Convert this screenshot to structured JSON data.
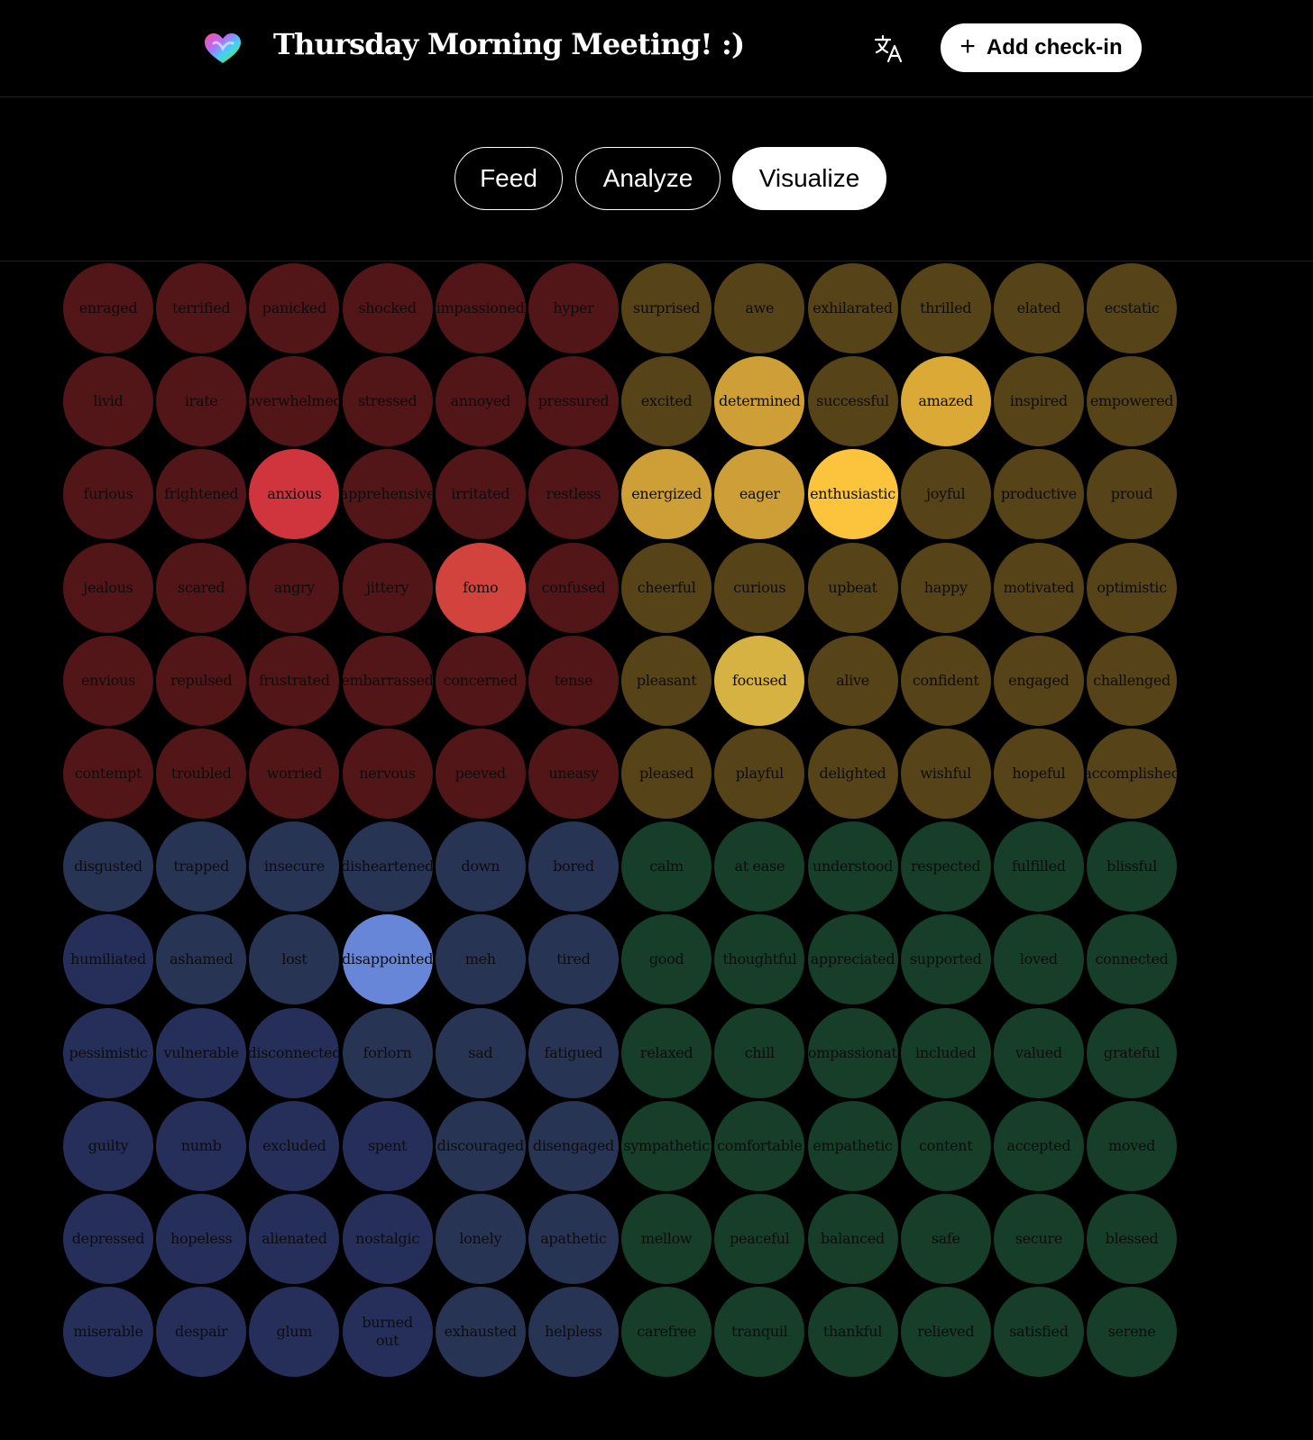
{
  "header": {
    "title": "Thursday Morning Meeting! :)",
    "logo_icon": "heart-logo-icon",
    "translate_icon": "translate-icon",
    "add_button_label": "Add check-in",
    "add_icon": "plus-icon"
  },
  "tabs": [
    {
      "label": "Feed",
      "active": false
    },
    {
      "label": "Analyze",
      "active": false
    },
    {
      "label": "Visualize",
      "active": true
    }
  ],
  "colors": {
    "red": "#521619",
    "red_active": "#d0353d",
    "red_active2": "#d2433d",
    "yellow": "#574318",
    "yellow_mid": "#cd9f36",
    "yellow_hi": "#dba935",
    "yellow_top": "#fcc43d",
    "yellow_focus": "#d6b242",
    "blue": "#283454",
    "blue_dark": "#262f5a",
    "blue_active": "#6886d7",
    "green": "#163e28"
  },
  "mood_rows": [
    [
      {
        "label": "enraged",
        "c": "red"
      },
      {
        "label": "terrified",
        "c": "red"
      },
      {
        "label": "panicked",
        "c": "red"
      },
      {
        "label": "shocked",
        "c": "red"
      },
      {
        "label": "impassioned",
        "c": "red"
      },
      {
        "label": "hyper",
        "c": "red"
      },
      {
        "label": "surprised",
        "c": "yellow"
      },
      {
        "label": "awe",
        "c": "yellow"
      },
      {
        "label": "exhilarated",
        "c": "yellow"
      },
      {
        "label": "thrilled",
        "c": "yellow"
      },
      {
        "label": "elated",
        "c": "yellow"
      },
      {
        "label": "ecstatic",
        "c": "yellow"
      }
    ],
    [
      {
        "label": "livid",
        "c": "red"
      },
      {
        "label": "irate",
        "c": "red"
      },
      {
        "label": "overwhelmed",
        "c": "red"
      },
      {
        "label": "stressed",
        "c": "red"
      },
      {
        "label": "annoyed",
        "c": "red"
      },
      {
        "label": "pressured",
        "c": "red"
      },
      {
        "label": "excited",
        "c": "yellow"
      },
      {
        "label": "determined",
        "c": "yellow_mid"
      },
      {
        "label": "successful",
        "c": "yellow"
      },
      {
        "label": "amazed",
        "c": "yellow_hi"
      },
      {
        "label": "inspired",
        "c": "yellow"
      },
      {
        "label": "empowered",
        "c": "yellow"
      }
    ],
    [
      {
        "label": "furious",
        "c": "red"
      },
      {
        "label": "frightened",
        "c": "red"
      },
      {
        "label": "anxious",
        "c": "red_active"
      },
      {
        "label": "apprehensive",
        "c": "red"
      },
      {
        "label": "irritated",
        "c": "red"
      },
      {
        "label": "restless",
        "c": "red"
      },
      {
        "label": "energized",
        "c": "yellow_mid"
      },
      {
        "label": "eager",
        "c": "yellow_mid"
      },
      {
        "label": "enthusiastic",
        "c": "yellow_top"
      },
      {
        "label": "joyful",
        "c": "yellow"
      },
      {
        "label": "productive",
        "c": "yellow"
      },
      {
        "label": "proud",
        "c": "yellow"
      }
    ],
    [
      {
        "label": "jealous",
        "c": "red"
      },
      {
        "label": "scared",
        "c": "red"
      },
      {
        "label": "angry",
        "c": "red"
      },
      {
        "label": "jittery",
        "c": "red"
      },
      {
        "label": "fomo",
        "c": "red_active2"
      },
      {
        "label": "confused",
        "c": "red"
      },
      {
        "label": "cheerful",
        "c": "yellow"
      },
      {
        "label": "curious",
        "c": "yellow"
      },
      {
        "label": "upbeat",
        "c": "yellow"
      },
      {
        "label": "happy",
        "c": "yellow"
      },
      {
        "label": "motivated",
        "c": "yellow"
      },
      {
        "label": "optimistic",
        "c": "yellow"
      }
    ],
    [
      {
        "label": "envious",
        "c": "red"
      },
      {
        "label": "repulsed",
        "c": "red"
      },
      {
        "label": "frustrated",
        "c": "red"
      },
      {
        "label": "embarrassed",
        "c": "red"
      },
      {
        "label": "concerned",
        "c": "red"
      },
      {
        "label": "tense",
        "c": "red"
      },
      {
        "label": "pleasant",
        "c": "yellow"
      },
      {
        "label": "focused",
        "c": "yellow_focus"
      },
      {
        "label": "alive",
        "c": "yellow"
      },
      {
        "label": "confident",
        "c": "yellow"
      },
      {
        "label": "engaged",
        "c": "yellow"
      },
      {
        "label": "challenged",
        "c": "yellow"
      }
    ],
    [
      {
        "label": "contempt",
        "c": "red"
      },
      {
        "label": "troubled",
        "c": "red"
      },
      {
        "label": "worried",
        "c": "red"
      },
      {
        "label": "nervous",
        "c": "red"
      },
      {
        "label": "peeved",
        "c": "red"
      },
      {
        "label": "uneasy",
        "c": "red"
      },
      {
        "label": "pleased",
        "c": "yellow"
      },
      {
        "label": "playful",
        "c": "yellow"
      },
      {
        "label": "delighted",
        "c": "yellow"
      },
      {
        "label": "wishful",
        "c": "yellow"
      },
      {
        "label": "hopeful",
        "c": "yellow"
      },
      {
        "label": "accomplished",
        "c": "yellow"
      }
    ],
    [
      {
        "label": "disgusted",
        "c": "blue"
      },
      {
        "label": "trapped",
        "c": "blue"
      },
      {
        "label": "insecure",
        "c": "blue"
      },
      {
        "label": "disheartened",
        "c": "blue"
      },
      {
        "label": "down",
        "c": "blue"
      },
      {
        "label": "bored",
        "c": "blue"
      },
      {
        "label": "calm",
        "c": "green"
      },
      {
        "label": "at ease",
        "c": "green"
      },
      {
        "label": "understood",
        "c": "green"
      },
      {
        "label": "respected",
        "c": "green"
      },
      {
        "label": "fulfilled",
        "c": "green"
      },
      {
        "label": "blissful",
        "c": "green"
      }
    ],
    [
      {
        "label": "humiliated",
        "c": "blue_dark"
      },
      {
        "label": "ashamed",
        "c": "blue"
      },
      {
        "label": "lost",
        "c": "blue"
      },
      {
        "label": "disappointed",
        "c": "blue_active"
      },
      {
        "label": "meh",
        "c": "blue"
      },
      {
        "label": "tired",
        "c": "blue"
      },
      {
        "label": "good",
        "c": "green"
      },
      {
        "label": "thoughtful",
        "c": "green"
      },
      {
        "label": "appreciated",
        "c": "green"
      },
      {
        "label": "supported",
        "c": "green"
      },
      {
        "label": "loved",
        "c": "green"
      },
      {
        "label": "connected",
        "c": "green"
      }
    ],
    [
      {
        "label": "pessimistic",
        "c": "blue_dark"
      },
      {
        "label": "vulnerable",
        "c": "blue_dark"
      },
      {
        "label": "disconnected",
        "c": "blue_dark"
      },
      {
        "label": "forlorn",
        "c": "blue"
      },
      {
        "label": "sad",
        "c": "blue"
      },
      {
        "label": "fatigued",
        "c": "blue"
      },
      {
        "label": "relaxed",
        "c": "green"
      },
      {
        "label": "chill",
        "c": "green"
      },
      {
        "label": "compassionate",
        "c": "green"
      },
      {
        "label": "included",
        "c": "green"
      },
      {
        "label": "valued",
        "c": "green"
      },
      {
        "label": "grateful",
        "c": "green"
      }
    ],
    [
      {
        "label": "guilty",
        "c": "blue_dark"
      },
      {
        "label": "numb",
        "c": "blue_dark"
      },
      {
        "label": "excluded",
        "c": "blue_dark"
      },
      {
        "label": "spent",
        "c": "blue_dark"
      },
      {
        "label": "discouraged",
        "c": "blue"
      },
      {
        "label": "disengaged",
        "c": "blue"
      },
      {
        "label": "sympathetic",
        "c": "green"
      },
      {
        "label": "comfortable",
        "c": "green"
      },
      {
        "label": "empathetic",
        "c": "green"
      },
      {
        "label": "content",
        "c": "green"
      },
      {
        "label": "accepted",
        "c": "green"
      },
      {
        "label": "moved",
        "c": "green"
      }
    ],
    [
      {
        "label": "depressed",
        "c": "blue_dark"
      },
      {
        "label": "hopeless",
        "c": "blue_dark"
      },
      {
        "label": "alienated",
        "c": "blue_dark"
      },
      {
        "label": "nostalgic",
        "c": "blue_dark"
      },
      {
        "label": "lonely",
        "c": "blue"
      },
      {
        "label": "apathetic",
        "c": "blue"
      },
      {
        "label": "mellow",
        "c": "green"
      },
      {
        "label": "peaceful",
        "c": "green"
      },
      {
        "label": "balanced",
        "c": "green"
      },
      {
        "label": "safe",
        "c": "green"
      },
      {
        "label": "secure",
        "c": "green"
      },
      {
        "label": "blessed",
        "c": "green"
      }
    ],
    [
      {
        "label": "miserable",
        "c": "blue_dark"
      },
      {
        "label": "despair",
        "c": "blue_dark"
      },
      {
        "label": "glum",
        "c": "blue_dark"
      },
      {
        "label": "burned out",
        "c": "blue_dark",
        "wrap": true
      },
      {
        "label": "exhausted",
        "c": "blue"
      },
      {
        "label": "helpless",
        "c": "blue"
      },
      {
        "label": "carefree",
        "c": "green"
      },
      {
        "label": "tranquil",
        "c": "green"
      },
      {
        "label": "thankful",
        "c": "green"
      },
      {
        "label": "relieved",
        "c": "green"
      },
      {
        "label": "satisfied",
        "c": "green"
      },
      {
        "label": "serene",
        "c": "green"
      }
    ]
  ]
}
